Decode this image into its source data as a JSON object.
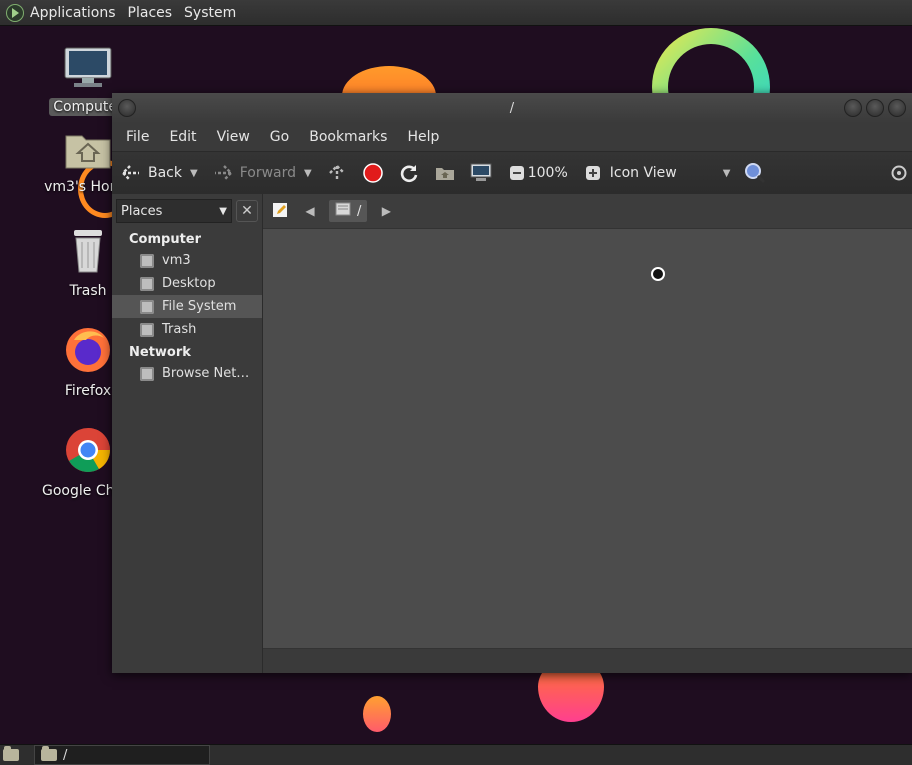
{
  "top_panel": {
    "menus": [
      "Applications",
      "Places",
      "System"
    ]
  },
  "desktop": {
    "icons": [
      {
        "label": "Computer",
        "icon": "computer-icon"
      },
      {
        "label": "vm3's Home",
        "icon": "home-folder-icon"
      },
      {
        "label": "Trash",
        "icon": "trash-icon"
      },
      {
        "label": "Firefox",
        "icon": "firefox-icon"
      },
      {
        "label": "Google Chrome",
        "icon": "chrome-icon"
      }
    ]
  },
  "window": {
    "title": "/",
    "menubar": [
      "File",
      "Edit",
      "View",
      "Go",
      "Bookmarks",
      "Help"
    ],
    "toolbar": {
      "back_label": "Back",
      "forward_label": "Forward",
      "zoom": "100%",
      "view_mode": "Icon View"
    },
    "sidebar": {
      "selector": "Places",
      "categories": [
        {
          "name": "Computer",
          "items": [
            "vm3",
            "Desktop",
            "File System",
            "Trash"
          ]
        },
        {
          "name": "Network",
          "items": [
            "Browse Net…"
          ]
        }
      ],
      "selected_item": "File System"
    },
    "path": {
      "crumb": "/"
    }
  },
  "bottom_panel": {
    "task_title": "/"
  },
  "colors": {
    "wallpaper": "#1f0d20",
    "stop_red": "#e11b1b"
  }
}
